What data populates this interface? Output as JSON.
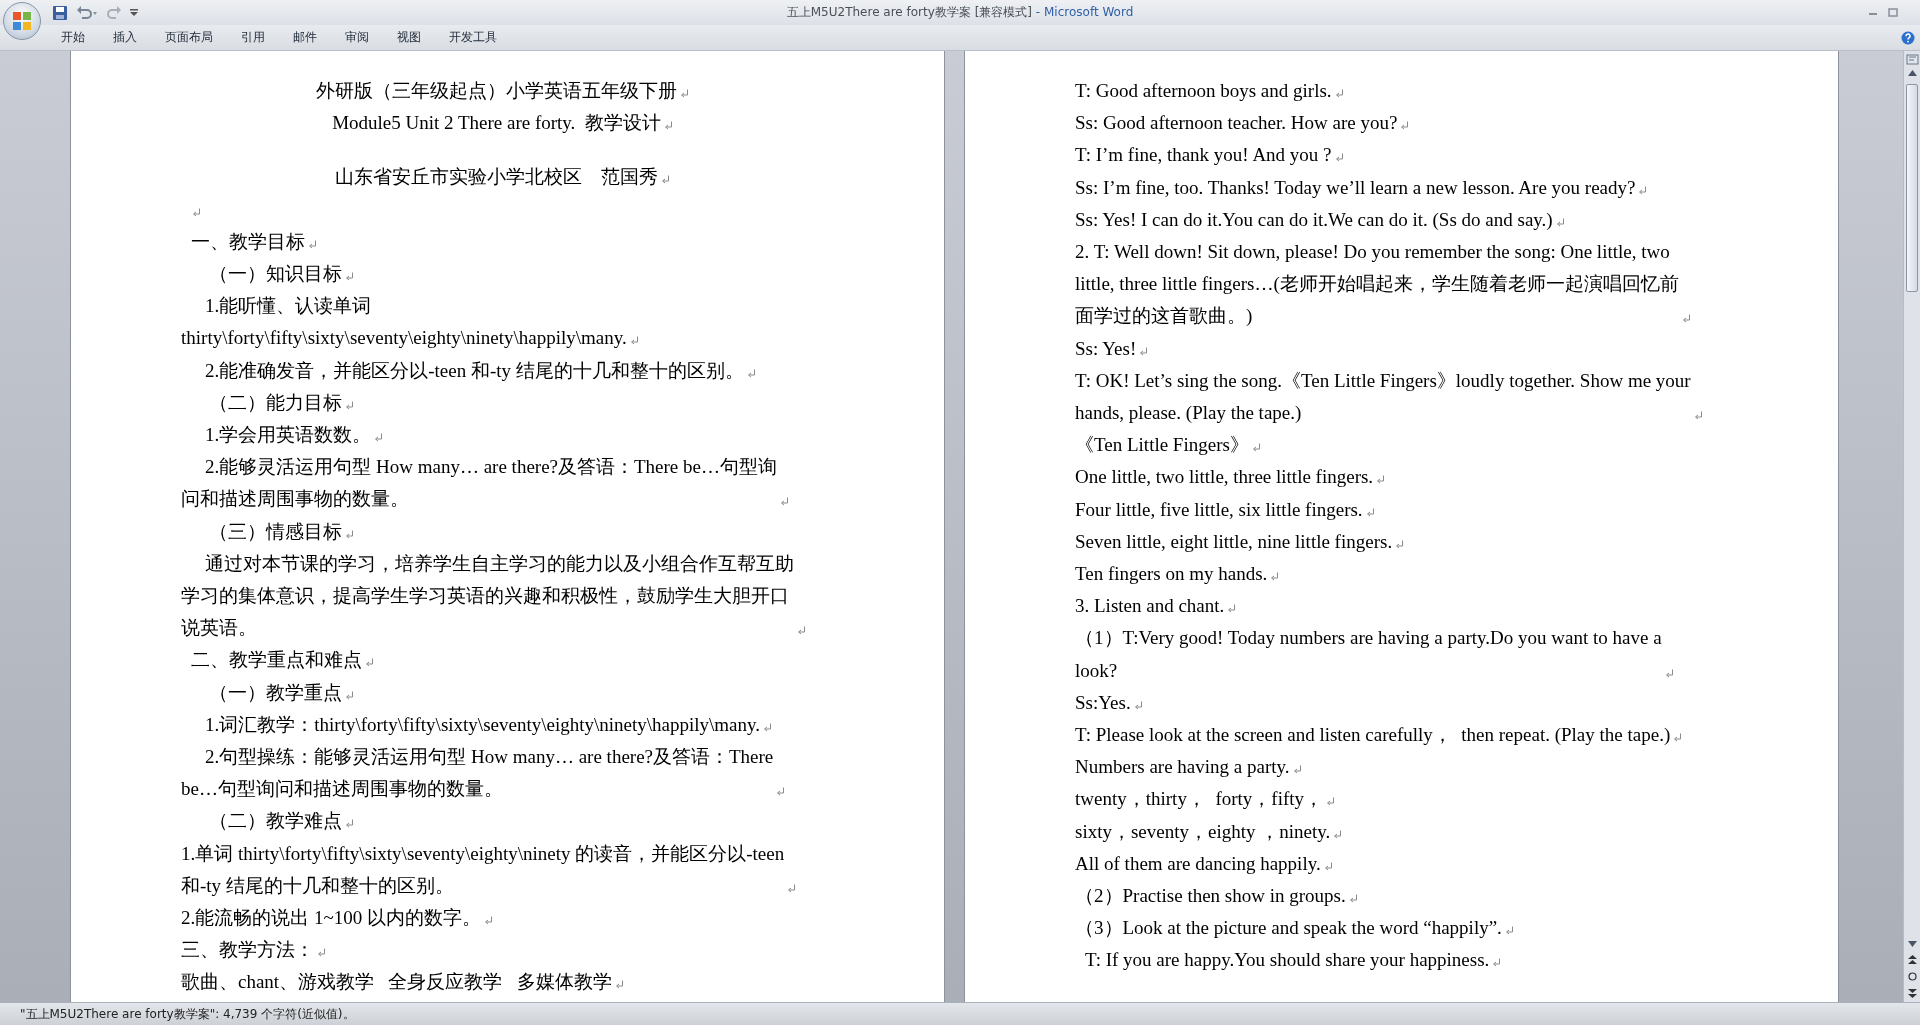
{
  "window": {
    "document": "五上M5U2There are forty教学案 [兼容模式]",
    "app": " - Microsoft Word"
  },
  "ribbon_tabs": [
    {
      "label": "开始"
    },
    {
      "label": "插入"
    },
    {
      "label": "页面布局"
    },
    {
      "label": "引用"
    },
    {
      "label": "邮件"
    },
    {
      "label": "审阅"
    },
    {
      "label": "视图"
    },
    {
      "label": "开发工具"
    }
  ],
  "pages": [
    {
      "paragraphs": [
        {
          "kind": "title",
          "lines": [
            "外研版（三年级起点）小学英语五年级下册"
          ]
        },
        {
          "kind": "title",
          "lines": [
            "Module5 Unit 2 There are forty.  教学设计"
          ]
        },
        {
          "kind": "author",
          "lines": [
            "山东省安丘市实验小学北校区    范国秀"
          ]
        },
        {
          "kind": "blank"
        },
        {
          "kind": "section",
          "lines": [
            "一、教学目标"
          ]
        },
        {
          "kind": "subsection",
          "lines": [
            "（一）知识目标"
          ]
        },
        {
          "kind": "item",
          "lines": [
            "1.能听懂、认读单词",
            "thirty\\forty\\fifty\\sixty\\seventy\\eighty\\ninety\\happily\\many."
          ]
        },
        {
          "kind": "item",
          "lines": [
            "2.能准确发音，并能区分以-teen 和-ty 结尾的十几和整十的区别。"
          ]
        },
        {
          "kind": "subsection",
          "lines": [
            "（二）能力目标"
          ]
        },
        {
          "kind": "item",
          "lines": [
            "1.学会用英语数数。"
          ]
        },
        {
          "kind": "item",
          "lines": [
            "2.能够灵活运用句型 How many… are there?及答语：There be…句型询",
            "问和描述周围事物的数量。"
          ]
        },
        {
          "kind": "subsection",
          "lines": [
            "（三）情感目标"
          ]
        },
        {
          "kind": "item",
          "lines": [
            "通过对本节课的学习，培养学生自主学习的能力以及小组合作互帮互助",
            "学习的集体意识，提高学生学习英语的兴趣和积极性，鼓励学生大胆开口",
            "说英语。"
          ]
        },
        {
          "kind": "section",
          "lines": [
            "二、教学重点和难点"
          ]
        },
        {
          "kind": "subsection",
          "lines": [
            "（一）教学重点"
          ]
        },
        {
          "kind": "item",
          "lines": [
            "1.词汇教学：thirty\\forty\\fifty\\sixty\\seventy\\eighty\\ninety\\happily\\many."
          ]
        },
        {
          "kind": "item",
          "lines": [
            "2.句型操练：能够灵活运用句型 How many… are there?及答语：There",
            "be…句型询问和描述周围事物的数量。"
          ]
        },
        {
          "kind": "subsection",
          "lines": [
            "（二）教学难点"
          ]
        },
        {
          "kind": "body",
          "lines": [
            "1.单词 thirty\\forty\\fifty\\sixty\\seventy\\eighty\\ninety 的读音，并能区分以-teen",
            "和-ty 结尾的十几和整十的区别。"
          ]
        },
        {
          "kind": "body",
          "lines": [
            "2.能流畅的说出 1~100 以内的数字。"
          ]
        },
        {
          "kind": "body",
          "lines": [
            "三、教学方法："
          ]
        },
        {
          "kind": "body",
          "lines": [
            "歌曲、chant、游戏教学   全身反应教学   多媒体教学"
          ]
        }
      ]
    },
    {
      "paragraphs": [
        {
          "kind": "body",
          "lines": [
            "T: Good afternoon boys and girls."
          ]
        },
        {
          "kind": "body",
          "lines": [
            "Ss: Good afternoon teacher. How are you?"
          ]
        },
        {
          "kind": "body",
          "lines": [
            "T: I’m fine, thank you! And you ?"
          ]
        },
        {
          "kind": "body",
          "lines": [
            "Ss: I’m fine, too. Thanks! Today we’ll learn a new lesson. Are you ready?"
          ]
        },
        {
          "kind": "body",
          "lines": [
            "Ss: Yes! I can do it.You can do it.We can do it. (Ss do and say.)"
          ]
        },
        {
          "kind": "body",
          "lines": [
            "2. T: Well down! Sit down, please! Do you remember the song: One little, two",
            "little, three little fingers…(老师开始唱起来，学生随着老师一起演唱回忆前",
            "面学过的这首歌曲。)"
          ]
        },
        {
          "kind": "body",
          "lines": [
            "Ss: Yes!"
          ]
        },
        {
          "kind": "body",
          "lines": [
            "T: OK! Let’s sing the song.《Ten Little Fingers》loudly together. Show me your",
            "hands, please. (Play the tape.)"
          ]
        },
        {
          "kind": "body",
          "lines": [
            "《Ten Little Fingers》"
          ]
        },
        {
          "kind": "body",
          "lines": [
            "One little, two little, three little fingers."
          ]
        },
        {
          "kind": "body",
          "lines": [
            "Four little, five little, six little fingers."
          ]
        },
        {
          "kind": "body",
          "lines": [
            "Seven little, eight little, nine little fingers."
          ]
        },
        {
          "kind": "body",
          "lines": [
            "Ten fingers on my hands."
          ]
        },
        {
          "kind": "body",
          "lines": [
            "3. Listen and chant."
          ]
        },
        {
          "kind": "body",
          "lines": [
            "（1）T:Very good! Today numbers are having a party.Do you want to have a",
            "look?"
          ]
        },
        {
          "kind": "body",
          "lines": [
            "Ss:Yes."
          ]
        },
        {
          "kind": "body",
          "lines": [
            "T: Please look at the screen and listen carefully，  then repeat. (Play the tape.)"
          ]
        },
        {
          "kind": "body",
          "lines": [
            "Numbers are having a party."
          ]
        },
        {
          "kind": "body",
          "lines": [
            "twenty，thirty，  forty，fifty，"
          ]
        },
        {
          "kind": "body",
          "lines": [
            "sixty，seventy，eighty ，ninety."
          ]
        },
        {
          "kind": "body",
          "lines": [
            "All of them are dancing happily."
          ]
        },
        {
          "kind": "body",
          "lines": [
            "（2）Practise then show in groups."
          ]
        },
        {
          "kind": "body",
          "lines": [
            "（3）Look at the picture and speak the word “happily”."
          ]
        },
        {
          "kind": "lead",
          "lines": [
            "T: If you are happy.You should share your happiness."
          ]
        }
      ]
    }
  ],
  "status_bar": {
    "text": "\"五上M5U2There are forty教学案\": 4,739 个字符(近似值)。"
  }
}
